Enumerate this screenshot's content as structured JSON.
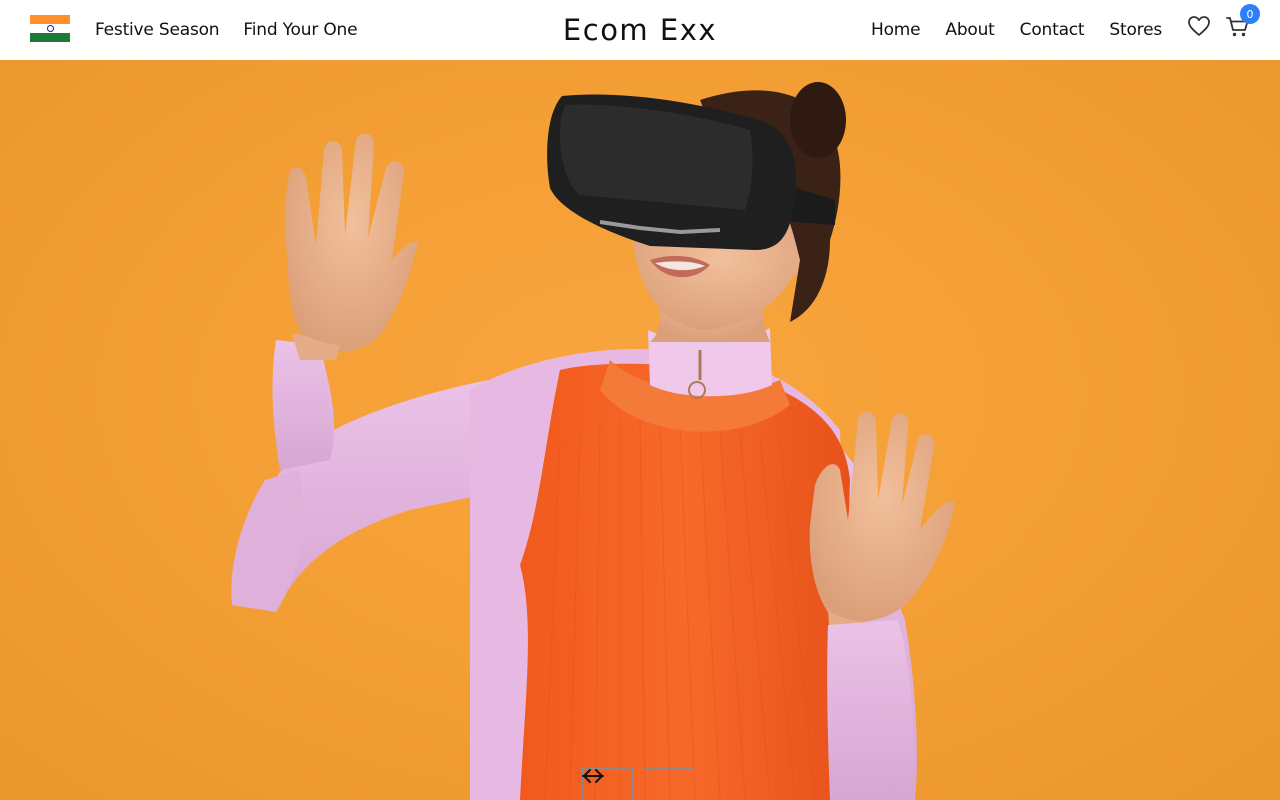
{
  "header": {
    "country_flag": "india-flag-icon",
    "left_links": [
      "Festive Season",
      "Find Your One"
    ],
    "brand": "Ecom Exx",
    "right_links": [
      "Home",
      "About",
      "Contact",
      "Stores"
    ],
    "wishlist_icon": "heart-icon",
    "cart_icon": "cart-icon",
    "cart_count": "0",
    "badge_color": "#2d7ff9"
  },
  "hero": {
    "background_color": "#f4a036",
    "prev_icon": "arrow-left-icon",
    "next_icon": "arrow-right-icon"
  }
}
